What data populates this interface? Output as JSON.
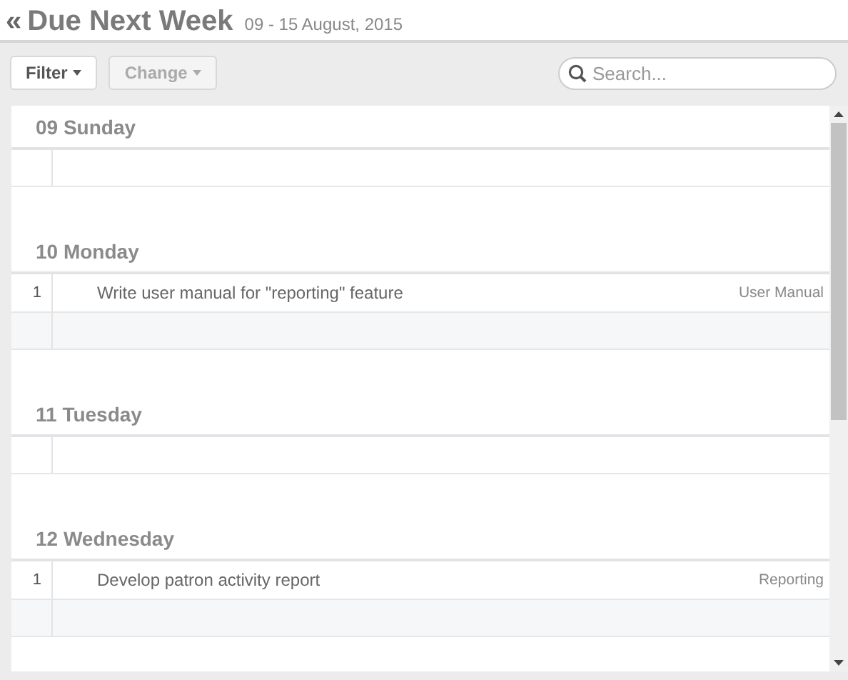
{
  "header": {
    "back": "«",
    "title": "Due Next Week",
    "date_range": "09 - 15 August, 2015"
  },
  "toolbar": {
    "buttons": [
      {
        "label": "Filter",
        "disabled": false
      },
      {
        "label": "Change",
        "disabled": true
      }
    ],
    "search": {
      "placeholder": "Search..."
    }
  },
  "days": [
    {
      "heading": "09 Sunday"
    },
    {
      "heading": "10 Monday",
      "tasks": [
        {
          "number": "1",
          "title": "Write user manual for \"reporting\" feature",
          "tag": "User Manual"
        }
      ]
    },
    {
      "heading": "11 Tuesday"
    },
    {
      "heading": "12 Wednesday",
      "tasks": [
        {
          "number": "1",
          "title": "Develop patron activity report",
          "tag": "Reporting"
        }
      ]
    }
  ]
}
